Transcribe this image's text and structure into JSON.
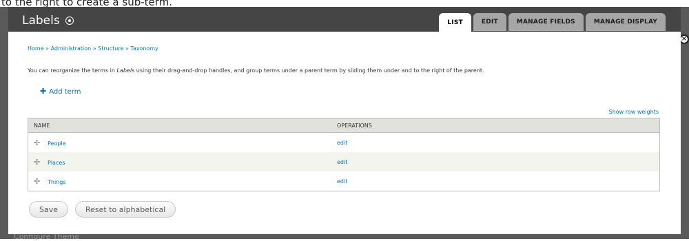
{
  "caption": "to the right to create a sub-term.",
  "background_text": "Configure Theme",
  "overlay": {
    "title": "Labels",
    "tabs": [
      {
        "label": "LIST",
        "active": true
      },
      {
        "label": "EDIT",
        "active": false
      },
      {
        "label": "MANAGE FIELDS",
        "active": false
      },
      {
        "label": "MANAGE DISPLAY",
        "active": false
      }
    ],
    "close_glyph": "×"
  },
  "breadcrumb": {
    "items": [
      "Home",
      "Administration",
      "Structure",
      "Taxonomy"
    ],
    "separator": "»"
  },
  "help": {
    "before": "You can reorganize the terms in ",
    "emphasis": "Labels",
    "after": " using their drag-and-drop handles, and group terms under a parent term by sliding them under and to the right of the parent."
  },
  "add_term": {
    "icon": "plus-icon",
    "label": "Add term"
  },
  "show_row_weights": "Show row weights",
  "table": {
    "headers": [
      "NAME",
      "OPERATIONS"
    ],
    "rows": [
      {
        "name": "People",
        "operation": "edit"
      },
      {
        "name": "Places",
        "operation": "edit"
      },
      {
        "name": "Things",
        "operation": "edit"
      }
    ]
  },
  "buttons": {
    "save": "Save",
    "reset": "Reset to alphabetical"
  },
  "colors": {
    "link": "#0074bd",
    "header_bar": "#454545",
    "tab_inactive": "#a6a6a6"
  }
}
